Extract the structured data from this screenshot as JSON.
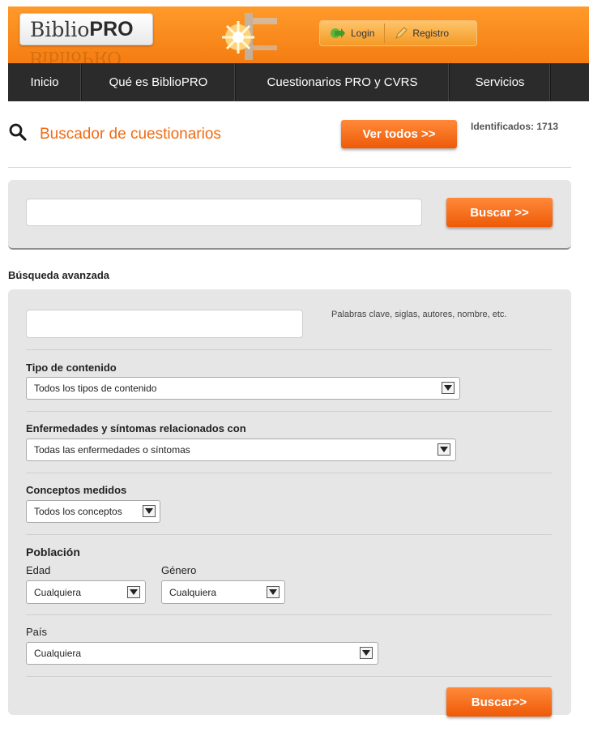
{
  "header": {
    "logo_biblio": "Biblio",
    "logo_pro": "PRO",
    "login_label": "Login",
    "register_label": "Registro"
  },
  "nav": {
    "items": [
      "Inicio",
      "Qué es BiblioPRO",
      "Cuestionarios PRO y CVRS",
      "Servicios"
    ]
  },
  "search": {
    "title": "Buscador de cuestionarios",
    "view_all_label": "Ver todos >>",
    "identified_label": "Identificados:",
    "identified_count": "1713",
    "search_button_label": "Buscar >>",
    "query_value": ""
  },
  "advanced": {
    "title": "Búsqueda avanzada",
    "keywords_value": "",
    "keywords_hint": "Palabras clave, siglas, autores, nombre, etc.",
    "content_type_label": "Tipo de contenido",
    "content_type_value": "Todos los tipos de contenido",
    "diseases_label": "Enfermedades y síntomas relacionados con",
    "diseases_value": "Todas las enfermedades o síntomas",
    "concepts_label": "Conceptos medidos",
    "concepts_value": "Todos los conceptos",
    "population_label": "Población",
    "age_label": "Edad",
    "age_value": "Cualquiera",
    "gender_label": "Género",
    "gender_value": "Cualquiera",
    "country_label": "País",
    "country_value": "Cualquiera",
    "search_button_label": "Buscar>>"
  },
  "colors": {
    "accent": "#f26a11",
    "header": "#f7861a",
    "nav": "#2b2b2b",
    "panel": "#e6e6e6"
  }
}
